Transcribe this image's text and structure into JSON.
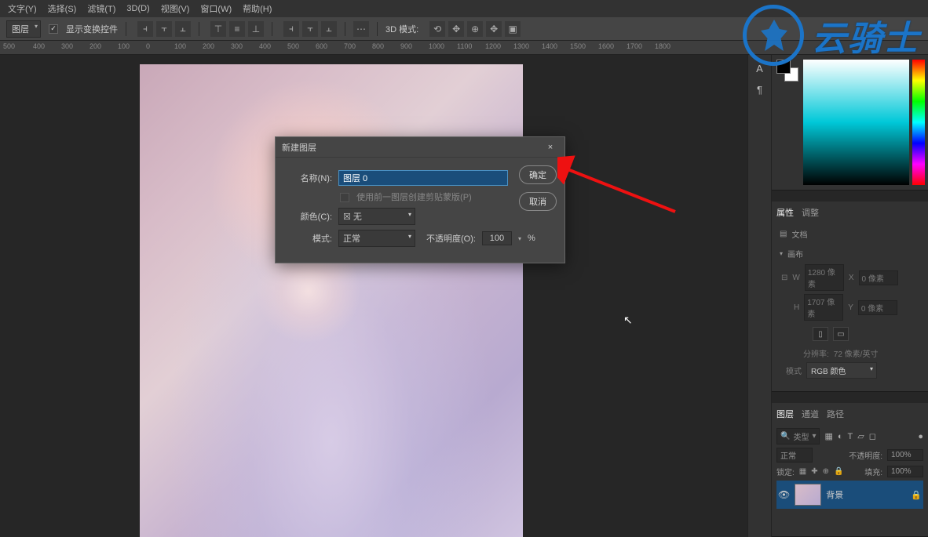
{
  "menubar": {
    "items": [
      "文字(Y)",
      "选择(S)",
      "滤镜(T)",
      "3D(D)",
      "视图(V)",
      "窗口(W)",
      "帮助(H)"
    ]
  },
  "optbar": {
    "layer_dropdown": "图层",
    "show_transform": "显示变换控件",
    "mode3d_label": "3D 模式:"
  },
  "ruler": {
    "ticks": [
      "500",
      "400",
      "300",
      "200",
      "100",
      "0",
      "100",
      "200",
      "300",
      "400",
      "500",
      "600",
      "700",
      "800",
      "900",
      "1000",
      "1100",
      "1200",
      "1300",
      "1400",
      "1500",
      "1600",
      "1700",
      "1800"
    ]
  },
  "dialog": {
    "title": "新建图层",
    "name_label": "名称(N):",
    "name_value": "图层 0",
    "clip_label": "使用前一图层创建剪贴蒙版(P)",
    "color_label": "颜色(C):",
    "color_value": "☒ 无",
    "mode_label": "模式:",
    "mode_value": "正常",
    "opacity_label": "不透明度(O):",
    "opacity_value": "100",
    "opacity_unit": "%",
    "ok": "确定",
    "cancel": "取消"
  },
  "panels": {
    "properties_tab": "属性",
    "adjust_tab": "调整",
    "doc_label": "文档",
    "canvas_label": "画布",
    "w_label": "W",
    "w_value": "1280 像素",
    "x_label": "X",
    "x_value": "0 像素",
    "h_label": "H",
    "h_value": "1707 像素",
    "y_label": "Y",
    "y_value": "0 像素",
    "res_label": "分辨率:",
    "res_value": "72 像素/英寸",
    "colormode_label": "模式",
    "colormode_value": "RGB 颜色",
    "layers_tab": "图层",
    "channels_tab": "通道",
    "paths_tab": "路径",
    "kind_label": "类型",
    "blend_value": "正常",
    "opacity_label": "不透明度:",
    "opacity_value": "100%",
    "lock_label": "锁定:",
    "fill_label": "填充:",
    "fill_value": "100%",
    "bg_layer": "背景"
  },
  "watermark": {
    "text": "云骑士"
  }
}
